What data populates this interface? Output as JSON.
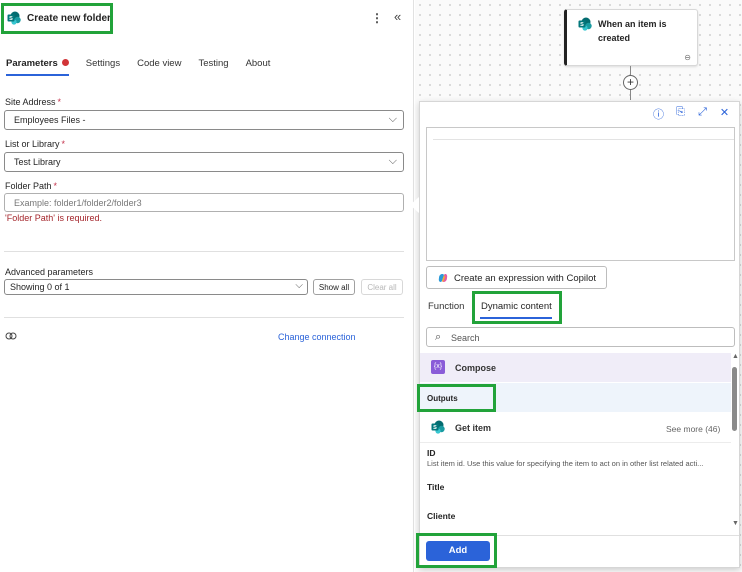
{
  "header": {
    "title": "Create new folder",
    "more_icon": "more-vertical-icon",
    "collapse_icon": "double-chevron-left-icon"
  },
  "tabs": [
    {
      "label": "Parameters",
      "active": true,
      "error": true
    },
    {
      "label": "Settings"
    },
    {
      "label": "Code view"
    },
    {
      "label": "Testing"
    },
    {
      "label": "About"
    }
  ],
  "fields": {
    "site_address": {
      "label": "Site Address",
      "required_mark": "*",
      "value": "Employees Files -"
    },
    "list_or_library": {
      "label": "List or Library",
      "required_mark": "*",
      "value": "Test Library"
    },
    "folder_path": {
      "label": "Folder Path",
      "required_mark": "*",
      "placeholder": "Example: folder1/folder2/folder3",
      "error": "'Folder Path' is required."
    }
  },
  "advanced": {
    "label": "Advanced parameters",
    "value": "Showing 0 of 1",
    "show_all": "Show all",
    "clear_all": "Clear all"
  },
  "connection": {
    "icon": "connection-icon",
    "change_label": "Change connection"
  },
  "canvas": {
    "trigger": {
      "title": "When an item is created",
      "link_icon": "link-icon"
    },
    "plus_icon": "plus-icon"
  },
  "flyout": {
    "icons": [
      "info-icon",
      "clipboard-icon",
      "expand-icon",
      "close-icon"
    ],
    "copilot_label": "Create an expression with Copilot",
    "tab_function": "Function",
    "tab_dynamic": "Dynamic content",
    "search_placeholder": "Search",
    "compose": {
      "label": "Compose",
      "icon_text": "{x}"
    },
    "outputs_label": "Outputs",
    "get_item": {
      "label": "Get item",
      "see_more": "See more (46)"
    },
    "items": [
      {
        "name": "ID",
        "description": "List item id. Use this value for specifying the item to act on in other list related acti..."
      },
      {
        "name": "Title"
      },
      {
        "name": "Cliente"
      }
    ],
    "add_label": "Add"
  },
  "colors": {
    "accent": "#2b63d9",
    "highlight": "#22a33a",
    "error": "#a4262c",
    "compose": "#8a5cd8"
  }
}
